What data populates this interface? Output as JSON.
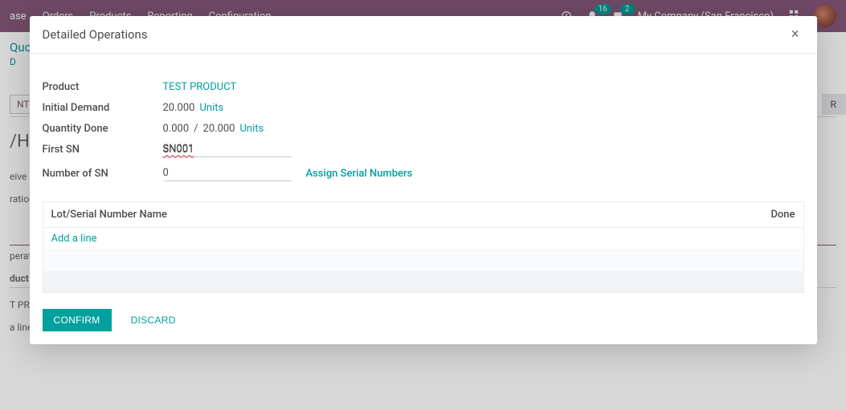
{
  "topbar": {
    "app_name": "ase",
    "nav": [
      "Orders",
      "Products",
      "Reporting",
      "Configuration"
    ],
    "badge_bell": "16",
    "badge_chat": "2",
    "company": "My Company (San Francisco)"
  },
  "background": {
    "breadcrumb": "Quot",
    "sub": "D",
    "btn_print_fragment": "NT",
    "status_right_fragment": "R",
    "ref_fragment": "/H/",
    "line1": "eive F",
    "line2": "ration",
    "section1": "peratic",
    "section2": "duct",
    "row1": "T PRC",
    "addline": "a line"
  },
  "modal": {
    "title": "Detailed Operations",
    "close": "×",
    "fields": {
      "product_label": "Product",
      "product_value": "TEST PRODUCT",
      "initial_demand_label": "Initial Demand",
      "initial_demand_value": "20.000",
      "initial_demand_unit": "Units",
      "qty_done_label": "Quantity Done",
      "qty_done_value": "0.000",
      "qty_done_separator": "/",
      "qty_done_total": "20.000",
      "qty_done_unit": "Units",
      "first_sn_label": "First SN",
      "first_sn_value": "SN001",
      "num_sn_label": "Number of SN",
      "num_sn_value": "0",
      "assign_link": "Assign Serial Numbers"
    },
    "table": {
      "col_name": "Lot/Serial Number Name",
      "col_done": "Done",
      "add_line": "Add a line"
    },
    "footer": {
      "confirm": "CONFIRM",
      "discard": "DISCARD"
    }
  }
}
